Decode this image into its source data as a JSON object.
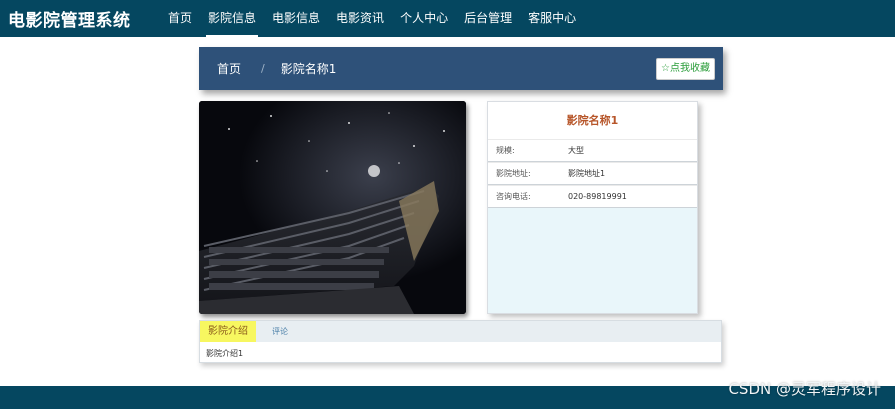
{
  "app": {
    "title": "电影院管理系统"
  },
  "nav": {
    "items": [
      {
        "label": "首页",
        "active": false
      },
      {
        "label": "影院信息",
        "active": true
      },
      {
        "label": "电影信息",
        "active": false
      },
      {
        "label": "电影资讯",
        "active": false
      },
      {
        "label": "个人中心",
        "active": false
      },
      {
        "label": "后台管理",
        "active": false
      },
      {
        "label": "客服中心",
        "active": false
      }
    ]
  },
  "breadcrumb": {
    "home": "首页",
    "separator": "/",
    "current": "影院名称1"
  },
  "favorite_button": {
    "label": "☆点我收藏"
  },
  "cinema": {
    "name": "影院名称1",
    "fields": [
      {
        "label": "规模:",
        "value": "大型"
      },
      {
        "label": "影院地址:",
        "value": "影院地址1"
      },
      {
        "label": "咨询电话:",
        "value": "020-89819991"
      }
    ]
  },
  "detail_tabs": {
    "tabs": [
      {
        "label": "影院介绍",
        "active": true
      },
      {
        "label": "评论",
        "active": false
      }
    ],
    "content": "影院介绍1"
  },
  "watermark": "CSDN @灵军程序设计",
  "colors": {
    "header": "#054760",
    "breadcrumb_bar": "#2e5179",
    "cinema_title": "#b7562a",
    "active_tab": "#f7f760",
    "info_card_bg": "#e9f6fa"
  }
}
